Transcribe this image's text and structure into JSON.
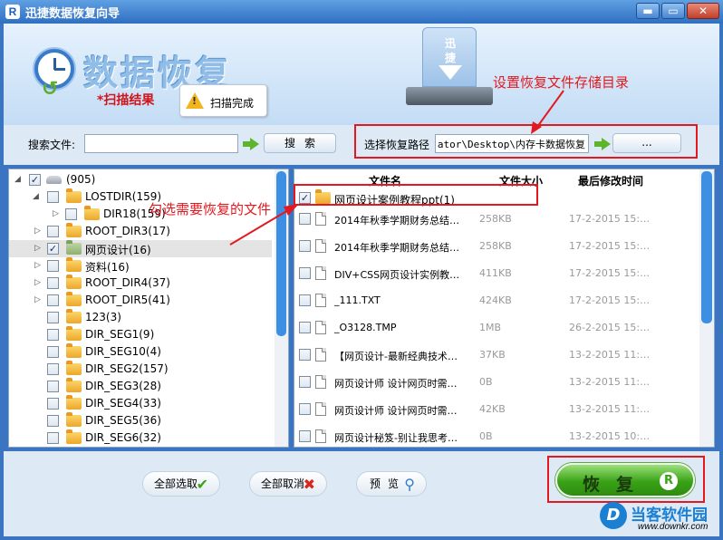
{
  "window": {
    "title": "迅捷数据恢复向导",
    "min_glyph": "▬",
    "max_glyph": "▭",
    "close_glyph": "✕"
  },
  "banner": {
    "title": "数据恢复",
    "scan_result": "*扫描结果",
    "scan_status": "扫描完成",
    "drive_label": "迅捷"
  },
  "annotations": {
    "set_dir": "设置恢复文件存储目录",
    "select_files": "勾选需要恢复的文件"
  },
  "search": {
    "label": "搜索文件:",
    "value": "",
    "button": "搜索"
  },
  "path": {
    "label": "选择恢复路径",
    "value": "ator\\Desktop\\内存卡数据恢复",
    "browse": "..."
  },
  "tree": {
    "items": [
      {
        "label": "(905)",
        "checked": true
      },
      {
        "label": "LOSTDIR(159)",
        "checked": false
      },
      {
        "label": "DIR18(159)",
        "checked": false
      },
      {
        "label": "ROOT_DIR3(17)",
        "checked": false
      },
      {
        "label": "网页设计(16)",
        "checked": true
      },
      {
        "label": "资料(16)",
        "checked": false
      },
      {
        "label": "ROOT_DIR4(37)",
        "checked": false
      },
      {
        "label": "ROOT_DIR5(41)",
        "checked": false
      },
      {
        "label": "123(3)",
        "checked": false
      },
      {
        "label": "DIR_SEG1(9)",
        "checked": false
      },
      {
        "label": "DIR_SEG10(4)",
        "checked": false
      },
      {
        "label": "DIR_SEG2(157)",
        "checked": false
      },
      {
        "label": "DIR_SEG3(28)",
        "checked": false
      },
      {
        "label": "DIR_SEG4(33)",
        "checked": false
      },
      {
        "label": "DIR_SEG5(36)",
        "checked": false
      },
      {
        "label": "DIR_SEG6(32)",
        "checked": false
      }
    ]
  },
  "files": {
    "headers": {
      "name": "文件名",
      "size": "文件大小",
      "modified": "最后修改时间"
    },
    "rows": [
      {
        "name": "网页设计案例教程ppt(1)",
        "size": "",
        "modified": "",
        "checked": true,
        "folder": true
      },
      {
        "name": "2014年秋季学期财务总结…",
        "size": "258KB",
        "modified": "17-2-2015  15:…",
        "checked": false
      },
      {
        "name": "2014年秋季学期财务总结…",
        "size": "258KB",
        "modified": "17-2-2015  15:…",
        "checked": false
      },
      {
        "name": "DIV+CSS网页设计实例教…",
        "size": "411KB",
        "modified": "17-2-2015  15:…",
        "checked": false
      },
      {
        "name": "_111.TXT",
        "size": "424KB",
        "modified": "17-2-2015  15:…",
        "checked": false
      },
      {
        "name": "_O3128.TMP",
        "size": "1MB",
        "modified": "26-2-2015  15:…",
        "checked": false
      },
      {
        "name": "【网页设计-最新经典技术…",
        "size": "37KB",
        "modified": "13-2-2015  11:…",
        "checked": false
      },
      {
        "name": "网页设计师  设计网页时需…",
        "size": "0B",
        "modified": "13-2-2015  11:…",
        "checked": false
      },
      {
        "name": "网页设计师  设计网页时需…",
        "size": "42KB",
        "modified": "13-2-2015  11:…",
        "checked": false
      },
      {
        "name": "网页设计秘笈-别让我思考…",
        "size": "0B",
        "modified": "13-2-2015  10:…",
        "checked": false
      }
    ]
  },
  "buttons": {
    "select_all": "全部选取",
    "deselect_all": "全部取消",
    "preview": "预览",
    "recover": "恢复"
  },
  "watermark": {
    "text": "当客软件园",
    "url": "www.downkr.com"
  },
  "colors": {
    "annotation": "#e2191f",
    "accent": "#3d8fe3",
    "recover_green": "#3aa217"
  }
}
